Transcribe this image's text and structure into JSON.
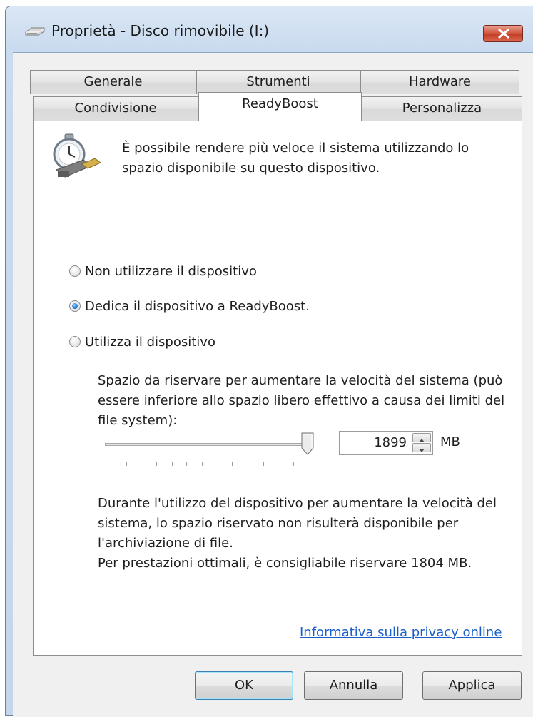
{
  "window": {
    "title": "Proprietà - Disco rimovibile (I:)",
    "title_icon": "removable-drive-icon",
    "close_icon": "close-icon"
  },
  "tabs": {
    "row_back": [
      "Generale",
      "Strumenti",
      "Hardware"
    ],
    "row_front": [
      "Condivisione",
      "ReadyBoost",
      "Personalizza"
    ],
    "active": "ReadyBoost"
  },
  "readyboost": {
    "icon": "readyboost-stopwatch-icon",
    "description": "È possibile rendere più veloce il sistema utilizzando lo spazio disponibile su questo dispositivo.",
    "options": [
      {
        "label": "Non utilizzare il dispositivo",
        "checked": false
      },
      {
        "label": "Dedica il dispositivo a ReadyBoost.",
        "checked": true
      },
      {
        "label": "Utilizza il dispositivo",
        "checked": false
      }
    ],
    "space_label": "Spazio da riservare per aumentare la velocità del sistema (può essere inferiore allo spazio libero effettivo a causa dei limiti del file system):",
    "slider_fraction": 1.0,
    "reserve_value": "1899",
    "unit": "MB",
    "info": "Durante l'utilizzo del dispositivo per aumentare la velocità del sistema, lo spazio riservato non risulterà disponibile per l'archiviazione di file.",
    "recommendation": "Per prestazioni ottimali, è consigliabile riservare 1804 MB.",
    "privacy_link": "Informativa sulla privacy online"
  },
  "buttons": {
    "ok": "OK",
    "cancel": "Annulla",
    "apply": "Applica"
  }
}
